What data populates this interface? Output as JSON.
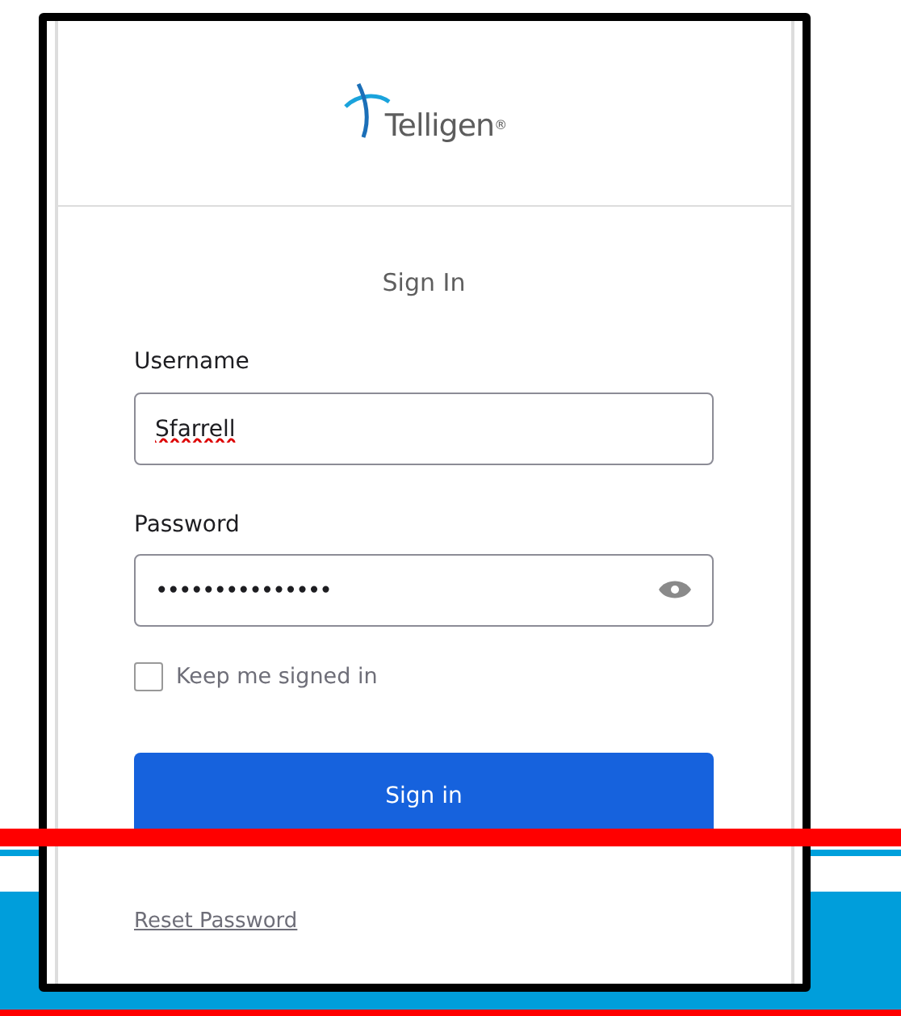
{
  "logo": {
    "text": "Telligen$^{®}$"
  },
  "form": {
    "title": "Sign In",
    "username": {
      "label": "Username",
      "value": "Sfarrell"
    },
    "password": {
      "label": "Password",
      "value": "•••••••••••••••"
    },
    "remember": {
      "label": "Keep me signed in",
      "checked": false
    },
    "submit": "Sign in",
    "reset_link": "Reset Password"
  }
}
